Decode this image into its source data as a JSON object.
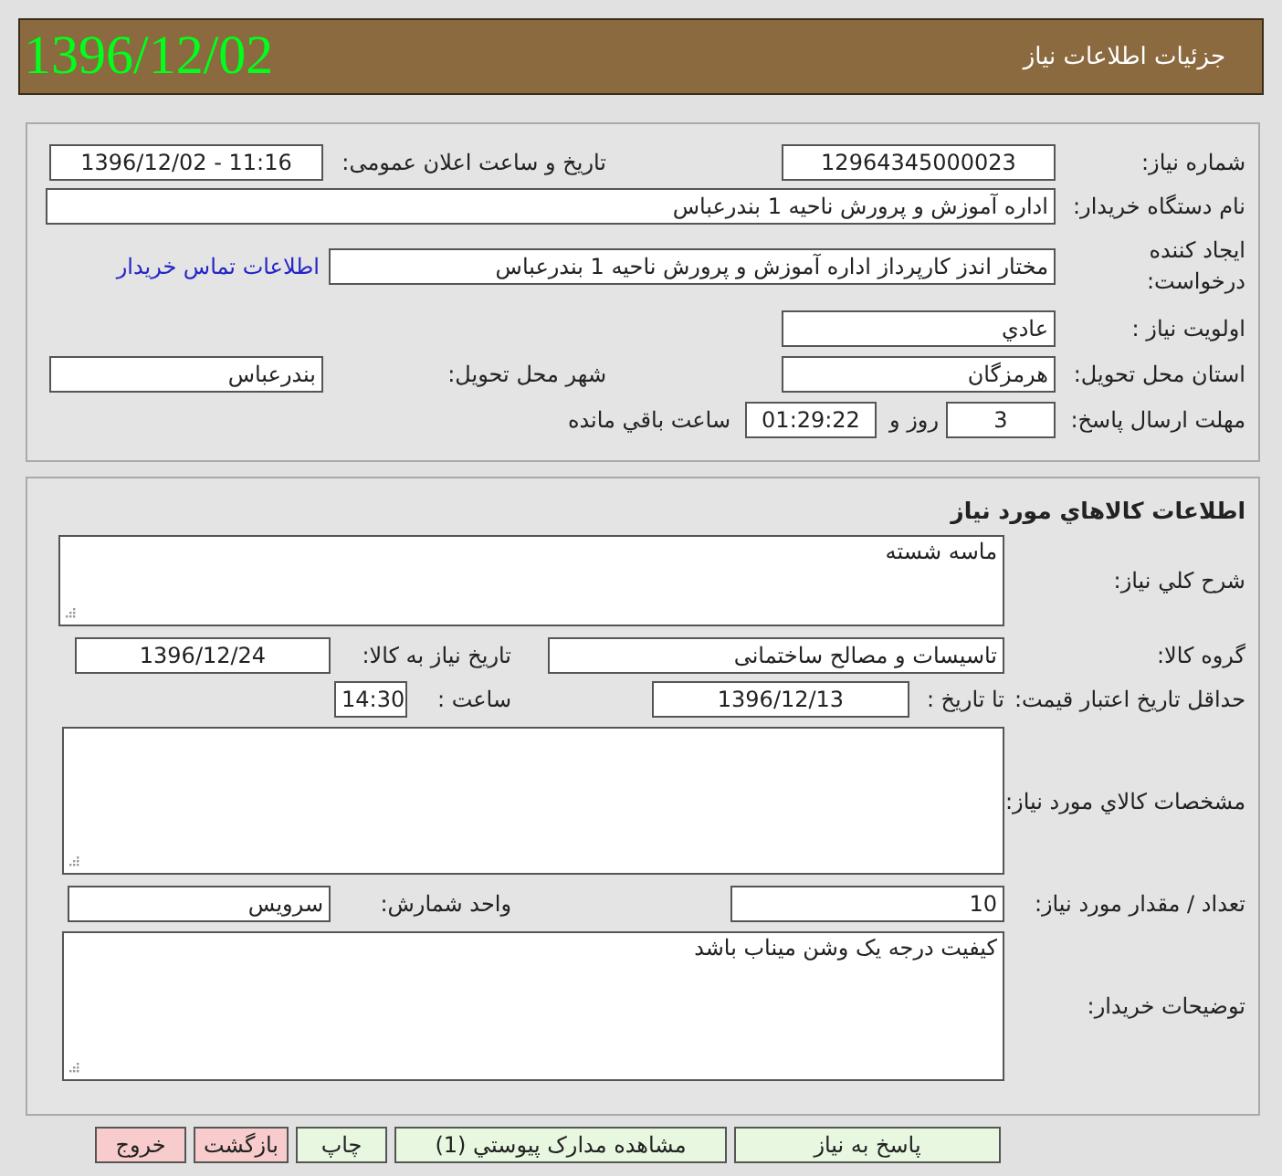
{
  "header": {
    "title": "جزئیات اطلاعات نیاز",
    "date": "1396/12/02"
  },
  "need_info": {
    "need_number": {
      "label": "شماره نیاز:",
      "value": "12964345000023"
    },
    "announce_datetime": {
      "label": "تاریخ و ساعت اعلان عمومی:",
      "value": "1396/12/02 - 11:16"
    },
    "buyer_org": {
      "label": "نام دستگاه خریدار:",
      "value": "اداره آموزش و پرورش ناحیه 1 بندرعباس"
    },
    "requester": {
      "label": "ایجاد کننده درخواست:",
      "value": "مختار اندز کارپرداز اداره آموزش و پرورش ناحیه 1 بندرعباس"
    },
    "buyer_contact_link": "اطلاعات تماس خریدار",
    "priority": {
      "label": "اولویت نیاز :",
      "value": "عادي"
    },
    "delivery_province": {
      "label": "استان محل تحویل:",
      "value": "هرمزگان"
    },
    "delivery_city": {
      "label": "شهر محل تحویل:",
      "value": "بندرعباس"
    },
    "response_deadline": {
      "label": "مهلت ارسال پاسخ:",
      "days": "3",
      "days_unit": "روز و",
      "time": "01:29:22",
      "time_suffix": "ساعت باقي مانده"
    }
  },
  "goods": {
    "title": "اطلاعات كالاهاي مورد نیاز",
    "description": {
      "label": "شرح كلي نیاز:",
      "value": "ماسه شسته"
    },
    "goods_group": {
      "label": "گروه كالا:",
      "value": "تاسیسات و مصالح ساختمانی"
    },
    "need_date": {
      "label": "تاریخ نیاز به كالا:",
      "value": "1396/12/24"
    },
    "price_validity": {
      "label": "حداقل تاریخ اعتبار قیمت:",
      "until_label": "تا تاریخ :",
      "date": "1396/12/13",
      "time_label": "ساعت :",
      "time": "14:30"
    },
    "specifications": {
      "label": "مشخصات كالاي مورد نیاز:"
    },
    "quantity": {
      "label": "تعداد / مقدار مورد نیاز:",
      "value": "10"
    },
    "unit": {
      "label": "واحد شمارش:",
      "value": "سرویس"
    },
    "buyer_notes": {
      "label": "توضیحات خریدار:",
      "value": "كیفیت درجه یک وشن میناب باشد"
    }
  },
  "buttons": [
    {
      "label": "پاسخ به نیاز",
      "kind": "primary"
    },
    {
      "label": "مشاهده مدارک پیوستي (1)",
      "kind": "primary"
    },
    {
      "label": "چاپ",
      "kind": "primary"
    },
    {
      "label": "بازگشت",
      "kind": "danger"
    },
    {
      "label": "خروج",
      "kind": "danger"
    }
  ]
}
